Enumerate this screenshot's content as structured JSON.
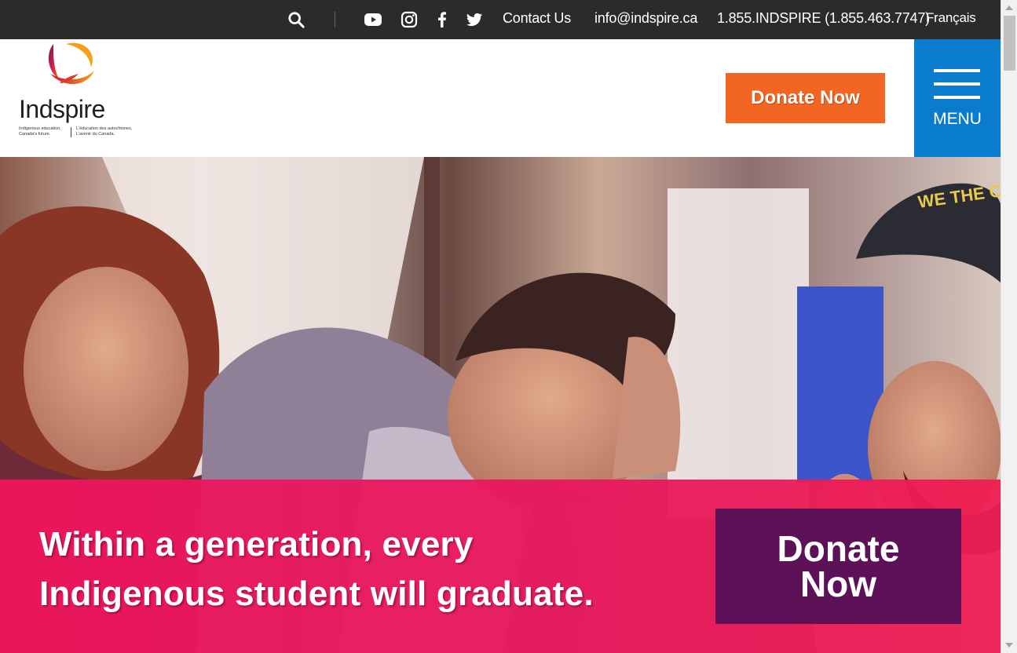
{
  "topbar": {
    "social": [
      "youtube-icon",
      "instagram-icon",
      "facebook-icon",
      "twitter-icon"
    ],
    "contact_label": "Contact Us",
    "email": "info@indspire.ca",
    "phone": "1.855.INDSPIRE (1.855.463.7747)",
    "language": "Français"
  },
  "header": {
    "logo_name": "Indspire",
    "logo_tag_en": "Indigenous education, Canada's future.",
    "logo_tag_fr": "L'éducation des autochtones, L'avenir du Canada.",
    "donate_label": "Donate Now",
    "menu_label": "MENU"
  },
  "hero": {
    "tagline_line1": "Within a generation, every",
    "tagline_line2": "Indigenous student will graduate.",
    "donate_line1": "Donate",
    "donate_line2": "Now",
    "cap_text": "WE THE CHAMPS"
  },
  "colors": {
    "topbar": "#2b2b2b",
    "donate_orange": "#f26522",
    "menu_blue": "#0a7ccd",
    "banner_pink": "#f0165c",
    "donate_purple": "#5d1157"
  }
}
